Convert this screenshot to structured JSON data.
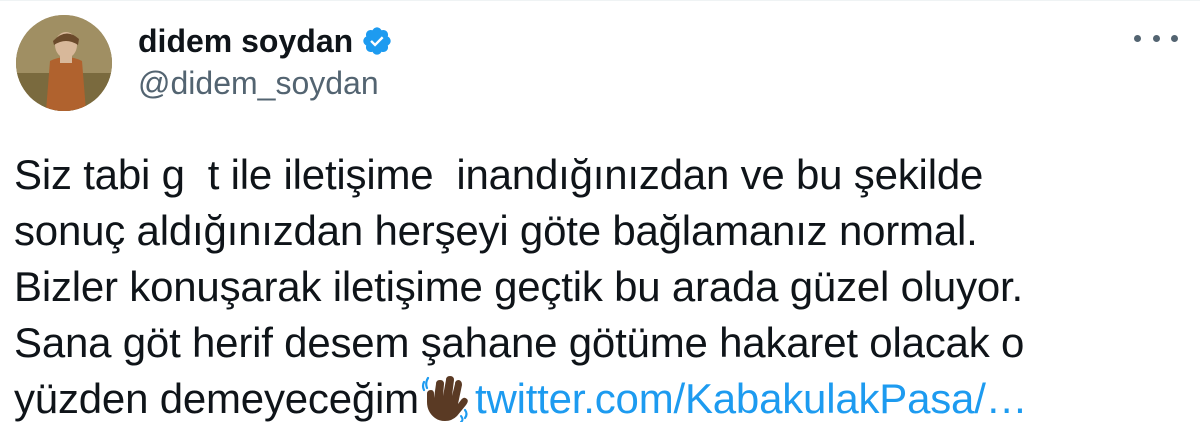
{
  "author": {
    "display_name": "didem soydan",
    "handle": "@didem_soydan",
    "verified": true,
    "verified_color": "#1d9bf0"
  },
  "tweet": {
    "lines": [
      "Siz tabi g  t ile iletişime  inandığınızdan ve bu şekilde",
      "sonuç aldığınızdan herşeyi göte bağlamanız normal.",
      "Bizler konuşarak iletişime geçtik bu arada güzel oluyor.",
      "Sana göt herif desem şahane götüme hakaret olacak o",
      "yüzden demeyeceğim"
    ],
    "emoji": "waving-hand-dark-skin-tone",
    "link_text": "twitter.com/KabakulakPasa/…",
    "link_color": "#1d9bf0"
  },
  "menu": {
    "icon": "more-horizontal-icon"
  }
}
